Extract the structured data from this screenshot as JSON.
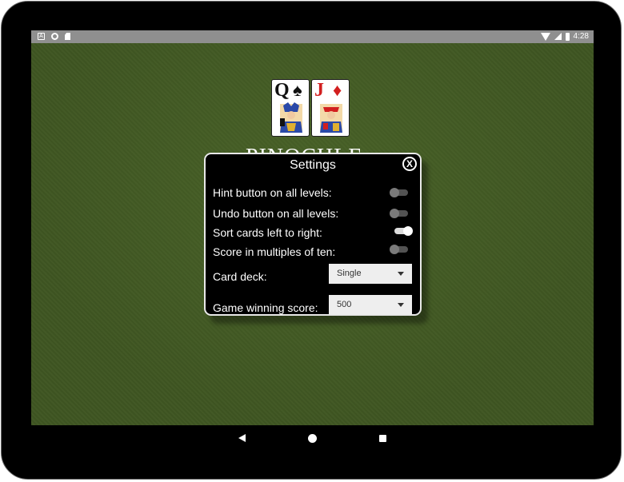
{
  "status_bar": {
    "time": "4:28",
    "left_icons": [
      "a-icon",
      "circle-icon",
      "sd-card-icon"
    ],
    "right_icons": [
      "wifi-icon",
      "signal-icon",
      "battery-icon"
    ]
  },
  "logo": {
    "card1_rank": "Q",
    "card1_suit": "♠",
    "card2_rank": "J",
    "card2_suit": "♦",
    "title": "PINOCHLE"
  },
  "dialog": {
    "title": "Settings",
    "close_label": "X",
    "settings": [
      {
        "label": "Hint button on all levels:",
        "on": false
      },
      {
        "label": "Undo button on all levels:",
        "on": false
      },
      {
        "label": "Sort cards left to right:",
        "on": true
      },
      {
        "label": "Score in multiples of ten:",
        "on": false
      }
    ],
    "card_deck": {
      "label": "Card deck:",
      "value": "Single"
    },
    "winning_score": {
      "label": "Game winning score:",
      "value": "500"
    }
  },
  "colors": {
    "felt": "#3f5622",
    "dialog_bg": "#000000",
    "toggle_on": "#ffffff",
    "red_suit": "#d21f1f"
  }
}
